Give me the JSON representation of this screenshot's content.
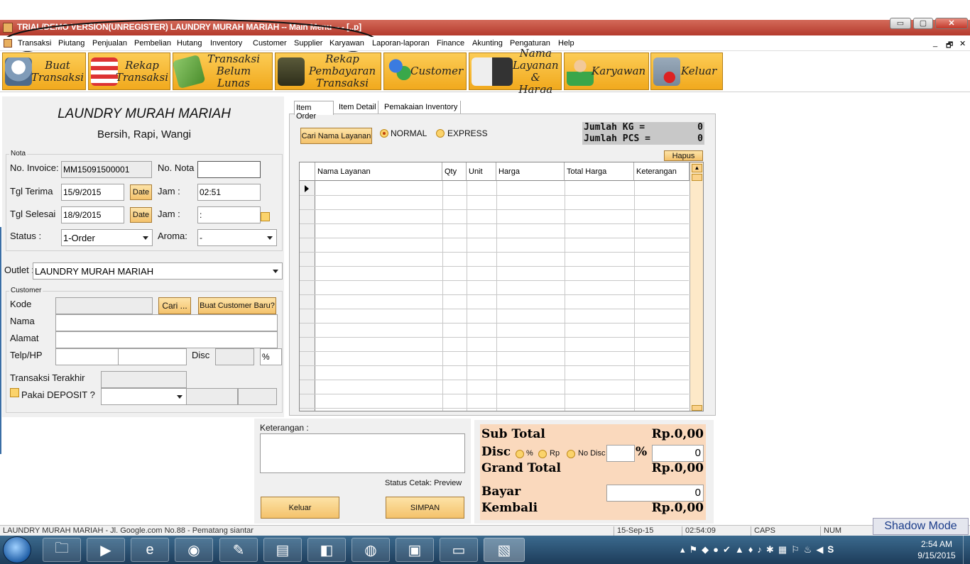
{
  "window": {
    "title": "TRIAL/DEMO VERSION(UNREGISTER) LAUNDRY MURAH MARIAH -- Main Menu -- - [..p]"
  },
  "menu": [
    "Transaksi",
    "Piutang",
    "Penjualan",
    "Pembelian",
    "Hutang",
    "Inventory",
    "Customer",
    "Supplier",
    "Karyawan",
    "Laporan-laporan",
    "Finance",
    "Akunting",
    "Pengaturan",
    "Help"
  ],
  "menu_right": {
    "min": "_",
    "restore": "🗗",
    "close": "✕"
  },
  "toolbar": [
    {
      "label": "Buat Transaksi",
      "icon": "basket-icon"
    },
    {
      "label": "Rekap Transaksi",
      "icon": "shop-icon"
    },
    {
      "label": "Transaksi Belum Lunas",
      "icon": "calculator-icon"
    },
    {
      "label": "Rekap Pembayaran Transaksi",
      "icon": "card-machine-icon"
    },
    {
      "label": "Customer",
      "icon": "customers-icon"
    },
    {
      "label": "Nama Layanan & Harga",
      "icon": "tshirt-icon"
    },
    {
      "label": "Karyawan",
      "icon": "employee-icon"
    },
    {
      "label": "Keluar",
      "icon": "exit-icon"
    }
  ],
  "header": {
    "company": "LAUNDRY MURAH MARIAH",
    "tagline": "Bersih, Rapi, Wangi"
  },
  "nota": {
    "group": "Nota",
    "invoice_label": "No. Invoice:",
    "invoice_value": "MM15091500001",
    "nota_label": "No. Nota",
    "nota_value": "",
    "tgl_terima_label": "Tgl Terima",
    "tgl_terima": "15/9/2015",
    "date_btn": "Date",
    "jam_label": "Jam :",
    "jam_terima": "02:51",
    "tgl_selesai_label": "Tgl Selesai",
    "tgl_selesai": "18/9/2015",
    "jam_selesai": " :",
    "status_label": "Status :",
    "status": "1-Order",
    "aroma_label": "Aroma:",
    "aroma": "-"
  },
  "outlet": {
    "label": "Outlet :",
    "value": "LAUNDRY MURAH MARIAH"
  },
  "customer": {
    "group": "Customer",
    "kode": "Kode",
    "nama": "Nama",
    "alamat": "Alamat",
    "telp": "Telp/HP",
    "disc": "Disc",
    "disc_unit": "%",
    "cari_btn": "Cari ...",
    "baru_btn": "Buat Customer Baru?",
    "transaksi_terakhir": "Transaksi Terakhir",
    "pakai_deposit": "Pakai DEPOSIT ?"
  },
  "tabs": [
    "Item Order",
    "Item Detail",
    "Pemakaian Inventory"
  ],
  "order": {
    "cari_btn": "Cari Nama Layanan",
    "normal": "NORMAL",
    "express": "EXPRESS",
    "jumlah_kg_label": "Jumlah KG =",
    "jumlah_kg": "0",
    "jumlah_pcs_label": "Jumlah PCS =",
    "jumlah_pcs": "0",
    "hapus_btn": "Hapus"
  },
  "grid": {
    "columns": [
      "Nama Layanan",
      "Qty",
      "Unit",
      "Harga",
      "Total Harga",
      "Keterangan"
    ]
  },
  "keterangan": {
    "label": "Keterangan :",
    "status_cetak": "Status Cetak: Preview",
    "keluar_btn": "Keluar",
    "simpan_btn": "SIMPAN"
  },
  "summary": {
    "sub_total_label": "Sub Total",
    "sub_total": "Rp.0,00",
    "disc_label": "Disc",
    "opt_pct": "%",
    "opt_rp": "Rp",
    "opt_nodisc": "No Disc",
    "pct_sign": "%",
    "disc_value": "0",
    "grand_total_label": "Grand Total",
    "grand_total": "Rp.0,00",
    "bayar_label": "Bayar",
    "bayar": "0",
    "kembali_label": "Kembali",
    "kembali": "Rp.0,00"
  },
  "statusbar": {
    "address": "LAUNDRY MURAH MARIAH - Jl. Google.com No.88 - Pematang siantar",
    "date": "15-Sep-15",
    "time": "02:54:09",
    "caps": "CAPS",
    "num": "NUM"
  },
  "shadow_mode": "Shadow Mode",
  "clock": {
    "time": "2:54 AM",
    "date": "9/15/2015"
  }
}
